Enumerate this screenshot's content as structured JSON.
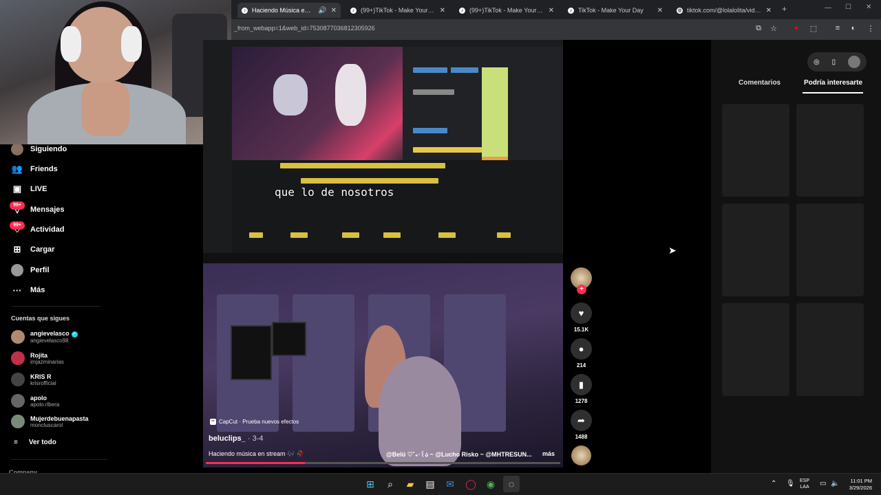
{
  "browser": {
    "tabs": [
      {
        "title": "Haciendo Música en Stream",
        "active": true
      },
      {
        "title": "(99+)TikTok - Make Your Day",
        "active": false
      },
      {
        "title": "(99+)TikTok - Make Your Day",
        "active": false
      },
      {
        "title": "TikTok - Make Your Day",
        "active": false
      },
      {
        "title": "tiktok.com/@lolalolita/video/7",
        "active": false
      }
    ],
    "new_tab": "+",
    "url": "_from_webapp=1&web_id=7530877036812305926"
  },
  "sidebar": {
    "nav": [
      {
        "label": "Siguiendo",
        "icon": "avatar-icon"
      },
      {
        "label": "Friends",
        "icon": "friends-icon"
      },
      {
        "label": "LIVE",
        "icon": "live-icon"
      },
      {
        "label": "Mensajes",
        "icon": "messages-icon",
        "badge": "99+"
      },
      {
        "label": "Actividad",
        "icon": "activity-icon",
        "badge": "99+"
      },
      {
        "label": "Cargar",
        "icon": "upload-icon"
      },
      {
        "label": "Perfil",
        "icon": "profile-icon"
      },
      {
        "label": "Más",
        "icon": "more-icon"
      }
    ],
    "following_title": "Cuentas que sigues",
    "accounts": [
      {
        "name": "angievelasco",
        "handle": "angievelasco98",
        "verified": true
      },
      {
        "name": "Rojita",
        "handle": "imjazminarias"
      },
      {
        "name": "KRIS R",
        "handle": "krisrofficial"
      },
      {
        "name": "apolo",
        "handle": "apolo.rlbera"
      },
      {
        "name": "Mujerdebuenapasta",
        "handle": "moncluscarol"
      }
    ],
    "see_all": "Ver todo",
    "company": "Company"
  },
  "video": {
    "caption": "que lo de nosotros",
    "capcut": "CapCut · Prueba nuevos efectos",
    "author": "beluclips_",
    "date": " · 3-4",
    "description": "Haciendo música en stream 🎶 🥀",
    "mentions": "@Belü ♡˚₊‧꒰ა ~ @Lucho Risko ~ @MHTRESUN...",
    "more": "más",
    "progress": 0.28
  },
  "actions": {
    "likes": "15.1K",
    "comments": "214",
    "saves": "1278",
    "shares": "1488"
  },
  "right_panel": {
    "tabs": [
      "Comentarios",
      "Podría interesarte"
    ],
    "active_tab": 1
  },
  "taskbar": {
    "lang_top": "ESP",
    "lang_bottom": "LAA",
    "time": "11:01 PM",
    "date": "3/29/2026"
  },
  "colors": {
    "accent": "#fe2c55",
    "verified": "#20d5ec"
  }
}
